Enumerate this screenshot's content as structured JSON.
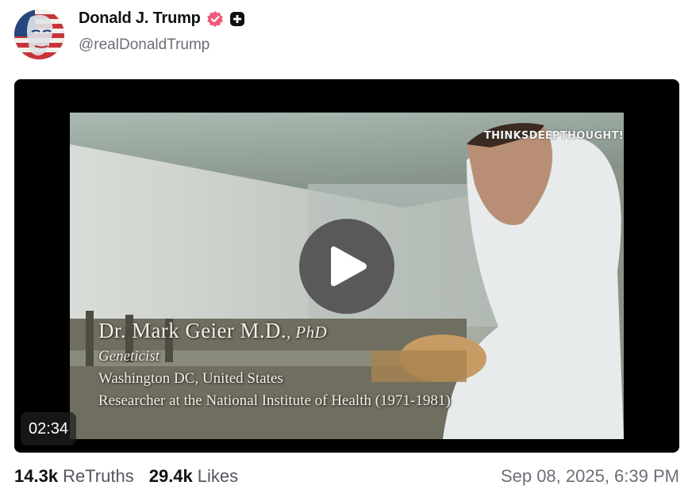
{
  "author": {
    "display_name": "Donald J. Trump",
    "handle": "@realDonaldTrump"
  },
  "media": {
    "duration": "02:34",
    "watermark": "THINKSDEEPTHOUGHT!",
    "caption": {
      "name": "Dr. Mark Geier M.D.",
      "degree": ", PhD",
      "title": "Geneticist",
      "location": "Washington DC, United States",
      "role": "Researcher at the National Institute of Health (1971-1981)"
    }
  },
  "stats": {
    "retruths_count": "14.3k",
    "retruths_label": "ReTruths",
    "likes_count": "29.4k",
    "likes_label": "Likes"
  },
  "timestamp": "Sep 08, 2025, 6:39 PM",
  "colors": {
    "verified_badge": "#f05a7a",
    "text_primary": "#111111",
    "text_secondary": "#6b6f78"
  },
  "icons": {
    "verified": "verified-badge-icon",
    "plus": "plus-badge-icon",
    "play": "play-icon"
  }
}
